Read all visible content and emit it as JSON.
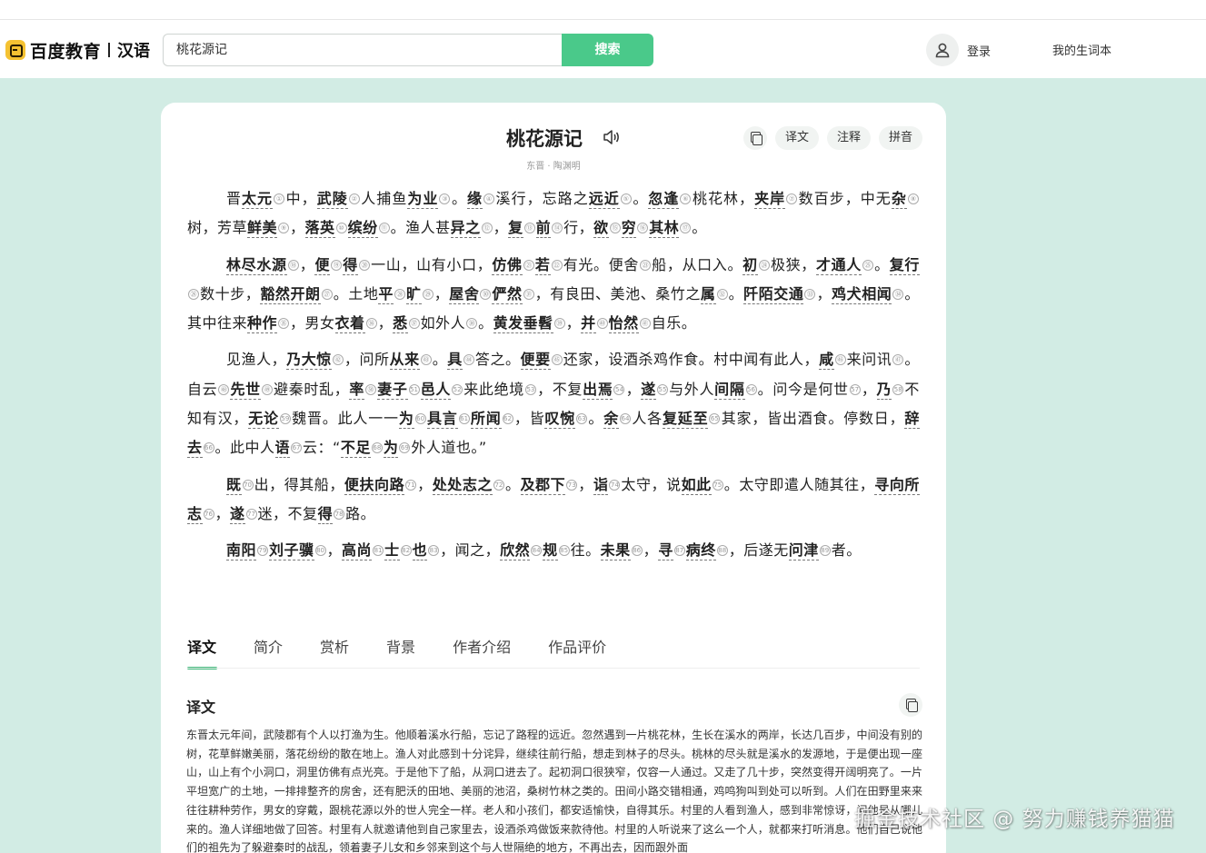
{
  "header": {
    "logo_text": "百度教育",
    "logo_sub": "汉语",
    "search_value": "桃花源记",
    "search_button": "搜索",
    "login": "登录",
    "vocab": "我的生词本"
  },
  "poem": {
    "title": "桃花源记",
    "author": "东晋 · 陶渊明",
    "tools": [
      "译文",
      "注释",
      "拼音"
    ],
    "paragraphs": [
      [
        [
          "晋",
          "t"
        ],
        [
          "太元",
          "k"
        ],
        [
          "1",
          "n"
        ],
        [
          "中，",
          "t"
        ],
        [
          "武陵",
          "k"
        ],
        [
          "2",
          "n"
        ],
        [
          "人捕鱼",
          "t"
        ],
        [
          "为业",
          "k"
        ],
        [
          "3",
          "n"
        ],
        [
          "。",
          "t"
        ],
        [
          "缘",
          "k"
        ],
        [
          "4",
          "n"
        ],
        [
          "溪行，",
          "t"
        ],
        [
          "忘路之",
          "t"
        ],
        [
          "远近",
          "k"
        ],
        [
          "5",
          "n"
        ],
        [
          "。",
          "t"
        ],
        [
          "忽逢",
          "k"
        ],
        [
          "6",
          "n"
        ],
        [
          "桃花林，",
          "t"
        ],
        [
          "夹岸",
          "k"
        ],
        [
          "7",
          "n"
        ],
        [
          "数百步，中无",
          "t"
        ],
        [
          "杂",
          "k"
        ],
        [
          "8",
          "n"
        ],
        [
          "树，芳草",
          "t"
        ],
        [
          "鲜美",
          "k"
        ],
        [
          "9",
          "n"
        ],
        [
          "，",
          "t"
        ],
        [
          "落英",
          "k"
        ],
        [
          "10",
          "n"
        ],
        [
          "缤纷",
          "k"
        ],
        [
          "11",
          "n"
        ],
        [
          "。渔人甚",
          "t"
        ],
        [
          "异之",
          "k"
        ],
        [
          "12",
          "n"
        ],
        [
          "，",
          "t"
        ],
        [
          "复",
          "k"
        ],
        [
          "13",
          "n"
        ],
        [
          "前",
          "k"
        ],
        [
          "14",
          "n"
        ],
        [
          "行，",
          "t"
        ],
        [
          "欲",
          "k"
        ],
        [
          "15",
          "n"
        ],
        [
          "穷",
          "k"
        ],
        [
          "16",
          "n"
        ],
        [
          "其林",
          "k"
        ],
        [
          "17",
          "n"
        ],
        [
          "。",
          "t"
        ]
      ],
      [
        [
          "林尽水源",
          "k"
        ],
        [
          "18",
          "n"
        ],
        [
          "，",
          "t"
        ],
        [
          "便",
          "k"
        ],
        [
          "19",
          "n"
        ],
        [
          "得",
          "k"
        ],
        [
          "20",
          "n"
        ],
        [
          "一山，山有小口，",
          "t"
        ],
        [
          "仿佛",
          "k"
        ],
        [
          "21",
          "n"
        ],
        [
          "若",
          "k"
        ],
        [
          "22",
          "n"
        ],
        [
          "有光。",
          "t"
        ],
        [
          "便舍",
          "t"
        ],
        [
          "23",
          "n"
        ],
        [
          "船，从口入。",
          "t"
        ],
        [
          "初",
          "k"
        ],
        [
          "24",
          "n"
        ],
        [
          "极狭，",
          "t"
        ],
        [
          "才通人",
          "k"
        ],
        [
          "25",
          "n"
        ],
        [
          "。",
          "t"
        ],
        [
          "复行",
          "k"
        ],
        [
          "26",
          "n"
        ],
        [
          "数十步，",
          "t"
        ],
        [
          "豁然开朗",
          "k"
        ],
        [
          "27",
          "n"
        ],
        [
          "。土地",
          "t"
        ],
        [
          "平",
          "k"
        ],
        [
          "28",
          "n"
        ],
        [
          "旷",
          "k"
        ],
        [
          "29",
          "n"
        ],
        [
          "，",
          "t"
        ],
        [
          "屋舍",
          "k"
        ],
        [
          "30",
          "n"
        ],
        [
          "俨然",
          "k"
        ],
        [
          "31",
          "n"
        ],
        [
          "，有良田、美池、桑竹之",
          "t"
        ],
        [
          "属",
          "k"
        ],
        [
          "32",
          "n"
        ],
        [
          "。",
          "t"
        ],
        [
          "阡陌交通",
          "k"
        ],
        [
          "33",
          "n"
        ],
        [
          "，",
          "t"
        ],
        [
          "鸡犬相闻",
          "k"
        ],
        [
          "34",
          "n"
        ],
        [
          "。其中往来",
          "t"
        ],
        [
          "种作",
          "k"
        ],
        [
          "35",
          "n"
        ],
        [
          "，男女",
          "t"
        ],
        [
          "衣着",
          "k"
        ],
        [
          "36",
          "n"
        ],
        [
          "，",
          "t"
        ],
        [
          "悉",
          "k"
        ],
        [
          "37",
          "n"
        ],
        [
          "如外人",
          "t"
        ],
        [
          "38",
          "n"
        ],
        [
          "。",
          "t"
        ],
        [
          "黄发垂髫",
          "k"
        ],
        [
          "39",
          "n"
        ],
        [
          "，",
          "t"
        ],
        [
          "并",
          "k"
        ],
        [
          "40",
          "n"
        ],
        [
          "怡然",
          "k"
        ],
        [
          "41",
          "n"
        ],
        [
          "自乐。",
          "t"
        ]
      ],
      [
        [
          "见渔人，",
          "t"
        ],
        [
          "乃大惊",
          "k"
        ],
        [
          "42",
          "n"
        ],
        [
          "，问所",
          "t"
        ],
        [
          "从来",
          "k"
        ],
        [
          "43",
          "n"
        ],
        [
          "。",
          "t"
        ],
        [
          "具",
          "k"
        ],
        [
          "44",
          "n"
        ],
        [
          "答之。",
          "t"
        ],
        [
          "便要",
          "k"
        ],
        [
          "45",
          "n"
        ],
        [
          "还家，设酒杀鸡作食。村中闻有此人，",
          "t"
        ],
        [
          "咸",
          "k"
        ],
        [
          "46",
          "n"
        ],
        [
          "来问讯",
          "t"
        ],
        [
          "47",
          "n"
        ],
        [
          "。自云",
          "t"
        ],
        [
          "48",
          "n"
        ],
        [
          "先世",
          "k"
        ],
        [
          "49",
          "n"
        ],
        [
          "避秦时乱，",
          "t"
        ],
        [
          "率",
          "k"
        ],
        [
          "50",
          "n"
        ],
        [
          "妻子",
          "k"
        ],
        [
          "51",
          "n"
        ],
        [
          "邑人",
          "k"
        ],
        [
          "52",
          "n"
        ],
        [
          "来此绝境",
          "t"
        ],
        [
          "53",
          "n"
        ],
        [
          "，不复",
          "t"
        ],
        [
          "出焉",
          "k"
        ],
        [
          "54",
          "n"
        ],
        [
          "，",
          "t"
        ],
        [
          "遂",
          "k"
        ],
        [
          "55",
          "n"
        ],
        [
          "与外人",
          "t"
        ],
        [
          "间隔",
          "k"
        ],
        [
          "56",
          "n"
        ],
        [
          "。问今是何世",
          "t"
        ],
        [
          "57",
          "n"
        ],
        [
          "，",
          "t"
        ],
        [
          "乃",
          "k"
        ],
        [
          "58",
          "n"
        ],
        [
          "不知有汉，",
          "t"
        ],
        [
          "无论",
          "k"
        ],
        [
          "59",
          "n"
        ],
        [
          "魏晋。此人一一",
          "t"
        ],
        [
          "为",
          "k"
        ],
        [
          "60",
          "n"
        ],
        [
          "具言",
          "k"
        ],
        [
          "61",
          "n"
        ],
        [
          "所闻",
          "k"
        ],
        [
          "62",
          "n"
        ],
        [
          "，皆",
          "t"
        ],
        [
          "叹惋",
          "k"
        ],
        [
          "63",
          "n"
        ],
        [
          "。",
          "t"
        ],
        [
          "余",
          "k"
        ],
        [
          "64",
          "n"
        ],
        [
          "人各",
          "t"
        ],
        [
          "复延至",
          "k"
        ],
        [
          "65",
          "n"
        ],
        [
          "其家，皆出酒食。停数日，",
          "t"
        ],
        [
          "辞去",
          "k"
        ],
        [
          "66",
          "n"
        ],
        [
          "。此中人",
          "t"
        ],
        [
          "语",
          "k"
        ],
        [
          "67",
          "n"
        ],
        [
          "云：“",
          "t"
        ],
        [
          "不足",
          "k"
        ],
        [
          "68",
          "n"
        ],
        [
          "为",
          "k"
        ],
        [
          "69",
          "n"
        ],
        [
          "外人道也。”",
          "t"
        ]
      ],
      [
        [
          "既",
          "k"
        ],
        [
          "70",
          "n"
        ],
        [
          "出，得其船，",
          "t"
        ],
        [
          "便扶向路",
          "k"
        ],
        [
          "71",
          "n"
        ],
        [
          "，",
          "t"
        ],
        [
          "处处志之",
          "k"
        ],
        [
          "72",
          "n"
        ],
        [
          "。",
          "t"
        ],
        [
          "及郡下",
          "k"
        ],
        [
          "73",
          "n"
        ],
        [
          "，",
          "t"
        ],
        [
          "诣",
          "k"
        ],
        [
          "74",
          "n"
        ],
        [
          "太守，说",
          "t"
        ],
        [
          "如此",
          "k"
        ],
        [
          "75",
          "n"
        ],
        [
          "。太守即遣人随其往，",
          "t"
        ],
        [
          "寻向所志",
          "k"
        ],
        [
          "76",
          "n"
        ],
        [
          "，",
          "t"
        ],
        [
          "遂",
          "k"
        ],
        [
          "77",
          "n"
        ],
        [
          "迷，不复",
          "t"
        ],
        [
          "得",
          "k"
        ],
        [
          "78",
          "n"
        ],
        [
          "路。",
          "t"
        ]
      ],
      [
        [
          "南阳",
          "k"
        ],
        [
          "79",
          "n"
        ],
        [
          "刘子骥",
          "k"
        ],
        [
          "80",
          "n"
        ],
        [
          "，",
          "t"
        ],
        [
          "高尚",
          "k"
        ],
        [
          "81",
          "n"
        ],
        [
          "士",
          "k"
        ],
        [
          "82",
          "n"
        ],
        [
          "也",
          "k"
        ],
        [
          "83",
          "n"
        ],
        [
          "，闻之，",
          "t"
        ],
        [
          "欣然",
          "k"
        ],
        [
          "84",
          "n"
        ],
        [
          "规",
          "k"
        ],
        [
          "85",
          "n"
        ],
        [
          "往。",
          "t"
        ],
        [
          "未果",
          "k"
        ],
        [
          "86",
          "n"
        ],
        [
          "，",
          "t"
        ],
        [
          "寻",
          "k"
        ],
        [
          "87",
          "n"
        ],
        [
          "病终",
          "k"
        ],
        [
          "88",
          "n"
        ],
        [
          "，后遂无",
          "t"
        ],
        [
          "问津",
          "k"
        ],
        [
          "89",
          "n"
        ],
        [
          "者。",
          "t"
        ]
      ]
    ]
  },
  "tabs": [
    "译文",
    "简介",
    "赏析",
    "背景",
    "作者介绍",
    "作品评价"
  ],
  "translation": {
    "title": "译文",
    "text": "东晋太元年间，武陵郡有个人以打渔为生。他顺着溪水行船，忘记了路程的远近。忽然遇到一片桃花林，生长在溪水的两岸，长达几百步，中间没有别的树，花草鲜嫩美丽，落花纷纷的散在地上。渔人对此感到十分诧异，继续往前行船，想走到林子的尽头。桃林的尽头就是溪水的发源地，于是便出现一座山，山上有个小洞口，洞里仿佛有点光亮。于是他下了船，从洞口进去了。起初洞口很狭窄，仅容一人通过。又走了几十步，突然变得开阔明亮了。一片平坦宽广的土地，一排排整齐的房舍，还有肥沃的田地、美丽的池沼，桑树竹林之类的。田间小路交错相通，鸡鸣狗叫到处可以听到。人们在田野里来来往往耕种劳作，男女的穿戴，跟桃花源以外的世人完全一样。老人和小孩们，都安适愉快，自得其乐。村里的人看到渔人，感到非常惊讶，问他是从哪儿来的。渔人详细地做了回答。村里有人就邀请他到自己家里去，设酒杀鸡做饭来款待他。村里的人听说来了这么一个人，就都来打听消息。他们自己说他们的祖先为了躲避秦时的战乱，领着妻子儿女和乡邻来到这个与人世隔绝的地方，不再出去，因而跟外面"
  },
  "watermark": "掘金技术社区 @ 努力赚钱养猫猫",
  "colors": {
    "accent": "#4ac98a",
    "page_bg": "#d2ece4"
  }
}
